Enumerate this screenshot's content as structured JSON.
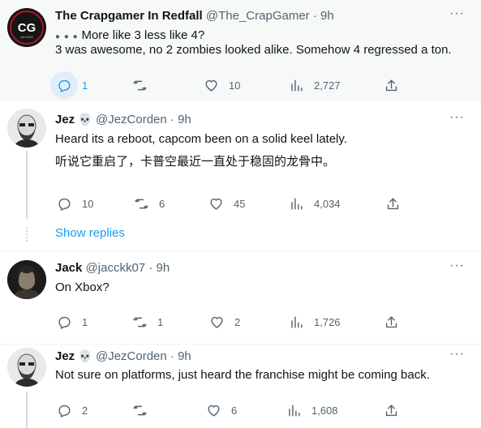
{
  "tweets": [
    {
      "name": "The Crapgamer In Redfall",
      "handle": "@The_CrapGamer",
      "time": "9h",
      "avatar_text": "CG",
      "avatar_sub": "est.2015",
      "lines": [
        "More like 3 less like 4?",
        "3 was awesome, no 2 zombies looked alike. Somehow 4 regressed a ton."
      ],
      "replies": "1",
      "retweets": "",
      "likes": "10",
      "views": "2,727"
    },
    {
      "name": "Jez",
      "handle": "@JezCorden",
      "time": "9h",
      "lines": [
        "Heard its a reboot, capcom been on a solid keel lately.",
        "听说它重启了，卡普空最近一直处于稳固的龙骨中。"
      ],
      "replies": "10",
      "retweets": "6",
      "likes": "45",
      "views": "4,034",
      "show_replies": "Show replies"
    },
    {
      "name": "Jack",
      "handle": "@jacckk07",
      "time": "9h",
      "lines": [
        "On Xbox?"
      ],
      "replies": "1",
      "retweets": "1",
      "likes": "2",
      "views": "1,726"
    },
    {
      "name": "Jez",
      "handle": "@JezCorden",
      "time": "9h",
      "lines": [
        "Not sure on platforms, just heard the franchise might be coming back."
      ],
      "replies": "2",
      "retweets": "",
      "likes": "6",
      "views": "1,608"
    }
  ],
  "colors": {
    "accent": "#1d9bf0",
    "muted": "#536471",
    "highlight_bg": "#f7f9f9"
  },
  "icons": {
    "reply": "reply-icon",
    "retweet": "retweet-icon",
    "like": "heart-icon",
    "views": "views-icon",
    "share": "share-icon",
    "more": "more-icon"
  }
}
